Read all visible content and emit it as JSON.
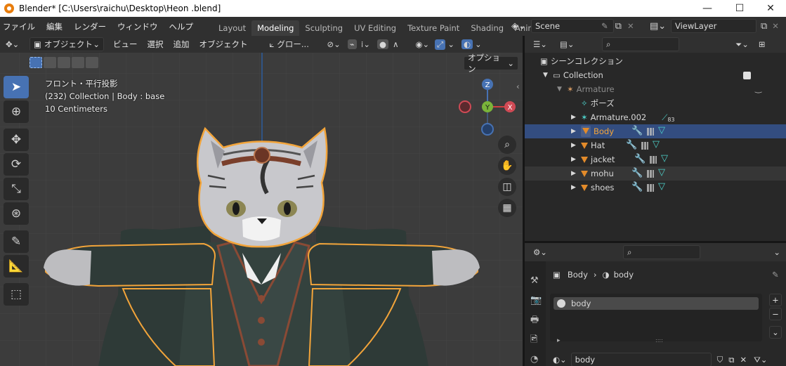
{
  "window": {
    "title": "Blender* [C:\\Users\\raichu\\Desktop\\Heon .blend]",
    "minimize": "—",
    "maximize": "☐",
    "close": "✕"
  },
  "menus": [
    "ファイル",
    "編集",
    "レンダー",
    "ウィンドウ",
    "ヘルプ"
  ],
  "workspace_tabs": [
    "Layout",
    "Modeling",
    "Sculpting",
    "UV Editing",
    "Texture Paint",
    "Shading",
    "Anima"
  ],
  "active_tab": "Modeling",
  "scene": {
    "name": "Scene",
    "view_layer": "ViewLayer"
  },
  "viewport_header": {
    "mode": "オブジェクト",
    "menus": [
      "ビュー",
      "選択",
      "追加",
      "オブジェクト"
    ],
    "transform_orientation": "グロー...",
    "options": "オプション"
  },
  "viewport_info": {
    "line1": "フロント・平行投影",
    "line2": "(232) Collection | Body : base",
    "line3": "10 Centimeters"
  },
  "gizmo": {
    "z": "Z",
    "y": "Y",
    "x": "X"
  },
  "outliner": {
    "root": "シーンコレクション",
    "items": [
      {
        "label": "Collection",
        "type": "collection",
        "indent": 1
      },
      {
        "label": "Armature",
        "type": "armature",
        "indent": 2,
        "dim": true
      },
      {
        "label": "ポーズ",
        "type": "pose",
        "indent": 3
      },
      {
        "label": "Armature.002",
        "type": "armature",
        "indent": 3,
        "badge": "83"
      },
      {
        "label": "Body",
        "type": "mesh",
        "indent": 3,
        "selected": true
      },
      {
        "label": "Hat",
        "type": "mesh",
        "indent": 3
      },
      {
        "label": "jacket",
        "type": "mesh",
        "indent": 3
      },
      {
        "label": "mohu",
        "type": "mesh",
        "indent": 3,
        "hover": true
      },
      {
        "label": "shoes",
        "type": "mesh",
        "indent": 3
      }
    ]
  },
  "properties": {
    "object": "Body",
    "material": "body",
    "slot": "body",
    "browse_material": "body",
    "plus": "+",
    "minus": "−",
    "dots": "::::",
    "arrow": "▸"
  },
  "colors": {
    "accent": "#4772b3",
    "selection_orange": "#f2a43a",
    "header": "#303030",
    "panel": "#282828",
    "viewport": "#3c3c3c"
  }
}
